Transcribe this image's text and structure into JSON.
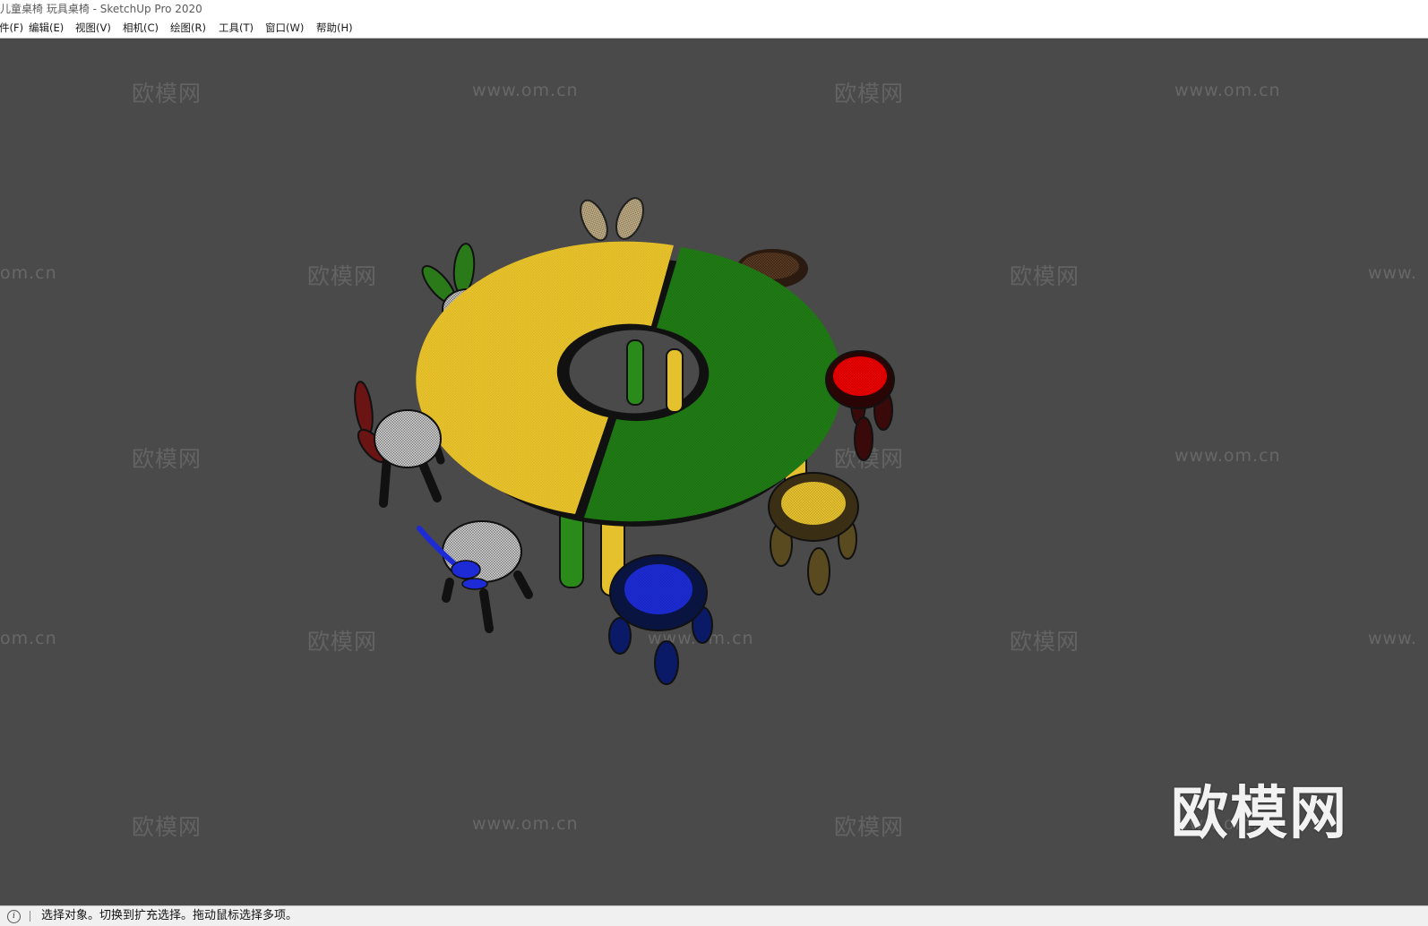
{
  "window": {
    "title": "儿童桌椅 玩具桌椅 - SketchUp Pro 2020"
  },
  "menu": {
    "items": [
      {
        "label": "件(F)"
      },
      {
        "label": "编辑(E)"
      },
      {
        "label": "视图(V)"
      },
      {
        "label": "相机(C)"
      },
      {
        "label": "绘图(R)"
      },
      {
        "label": "工具(T)"
      },
      {
        "label": "窗口(W)"
      },
      {
        "label": "帮助(H)"
      }
    ]
  },
  "watermarks": {
    "brand": "欧模网",
    "url": "www.om.cn",
    "url_partial_left": "om.cn",
    "url_partial_right": "www."
  },
  "logo": {
    "text": "欧模网"
  },
  "model": {
    "table_colors": {
      "left": "#e8c22a",
      "right": "#1f7a14"
    },
    "stool_colors": [
      "#c9c9c9",
      "#7a1414",
      "#1c2bd6",
      "#f00000",
      "#e6c12e",
      "#5a3a22",
      "#c8c8c8"
    ]
  },
  "status": {
    "icon": "info-icon",
    "text": "选择对象。切换到扩充选择。拖动鼠标选择多项。"
  }
}
